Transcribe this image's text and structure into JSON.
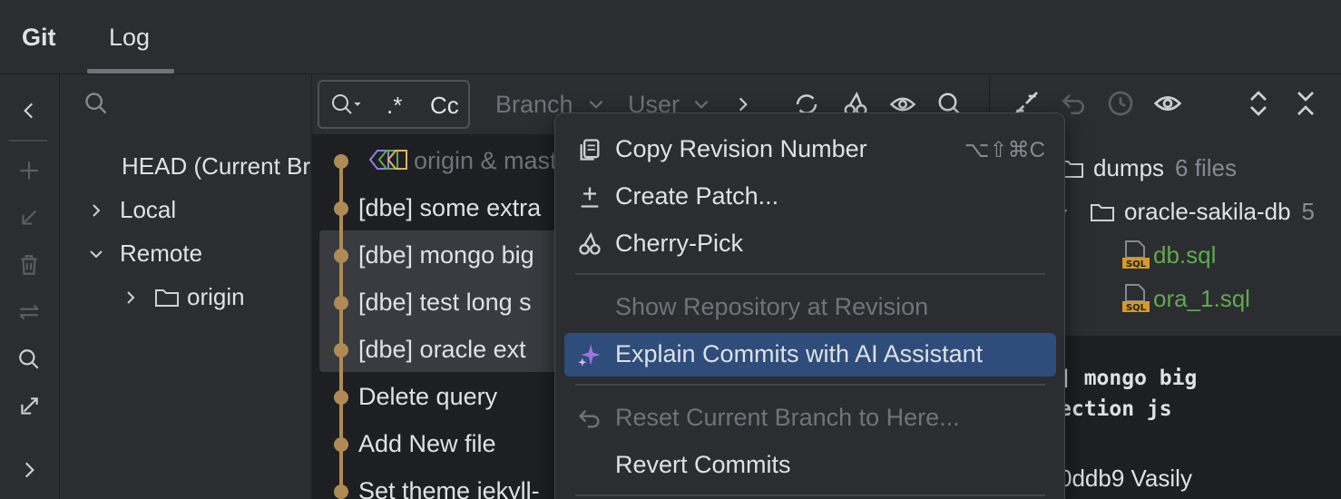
{
  "tabs": {
    "git": "Git",
    "log": "Log"
  },
  "toolstrip": {
    "icons": [
      "collapse-left-icon",
      "add-icon",
      "fetch-icon",
      "delete-icon",
      "compare-icon",
      "search-icon",
      "update-icon",
      "expand-right-icon"
    ]
  },
  "branches": {
    "head": "HEAD (Current Branch)",
    "local": "Local",
    "remote": "Remote",
    "origin": "origin"
  },
  "log": {
    "search": {
      "regex": ".*",
      "case": "Cc"
    },
    "filters": {
      "branch": "Branch",
      "user": "User"
    },
    "commits": [
      {
        "message": "origin & master",
        "ref": true
      },
      {
        "message": "[dbe] some extra"
      },
      {
        "message": "[dbe] mongo big"
      },
      {
        "message": "[dbe] test long s"
      },
      {
        "message": "[dbe] oracle ext"
      },
      {
        "message": "Delete query"
      },
      {
        "message": "Add New file"
      },
      {
        "message": "Set theme jekyll-"
      }
    ]
  },
  "details": {
    "tree": {
      "dumps": "dumps",
      "dumps_count": "6 files",
      "folder": "oracle-sakila-db",
      "folder_count": "5",
      "files": [
        "db.sql",
        "ora_1.sql"
      ]
    },
    "message_lines": [
      "] mongo big",
      "ection js"
    ],
    "hash_line": "0ddb9 Vasily"
  },
  "context_menu": {
    "items": [
      {
        "label": "Copy Revision Number",
        "shortcut": "⌥⇧⌘C",
        "icon": "copy-icon",
        "disabled": false
      },
      {
        "label": "Create Patch...",
        "shortcut": "",
        "icon": "patch-icon",
        "disabled": false
      },
      {
        "label": "Cherry-Pick",
        "shortcut": "",
        "icon": "cherry-icon",
        "disabled": false
      },
      {
        "label": "Show Repository at Revision",
        "shortcut": "",
        "icon": "",
        "disabled": true
      },
      {
        "label": "Explain Commits with AI Assistant",
        "shortcut": "",
        "icon": "ai-sparkle-icon",
        "disabled": false,
        "highlighted": true
      },
      {
        "label": "Reset Current Branch to Here...",
        "shortcut": "",
        "icon": "reset-icon",
        "disabled": true
      },
      {
        "label": "Revert Commits",
        "shortcut": "",
        "icon": "",
        "disabled": false
      }
    ]
  },
  "colors": {
    "background": "#2b2d30",
    "log_background": "#1e1f22",
    "graph": "#b08a55",
    "highlight": "#2e4d7a",
    "added_file": "#5faa4f",
    "ai_accent": "#a571e6"
  }
}
